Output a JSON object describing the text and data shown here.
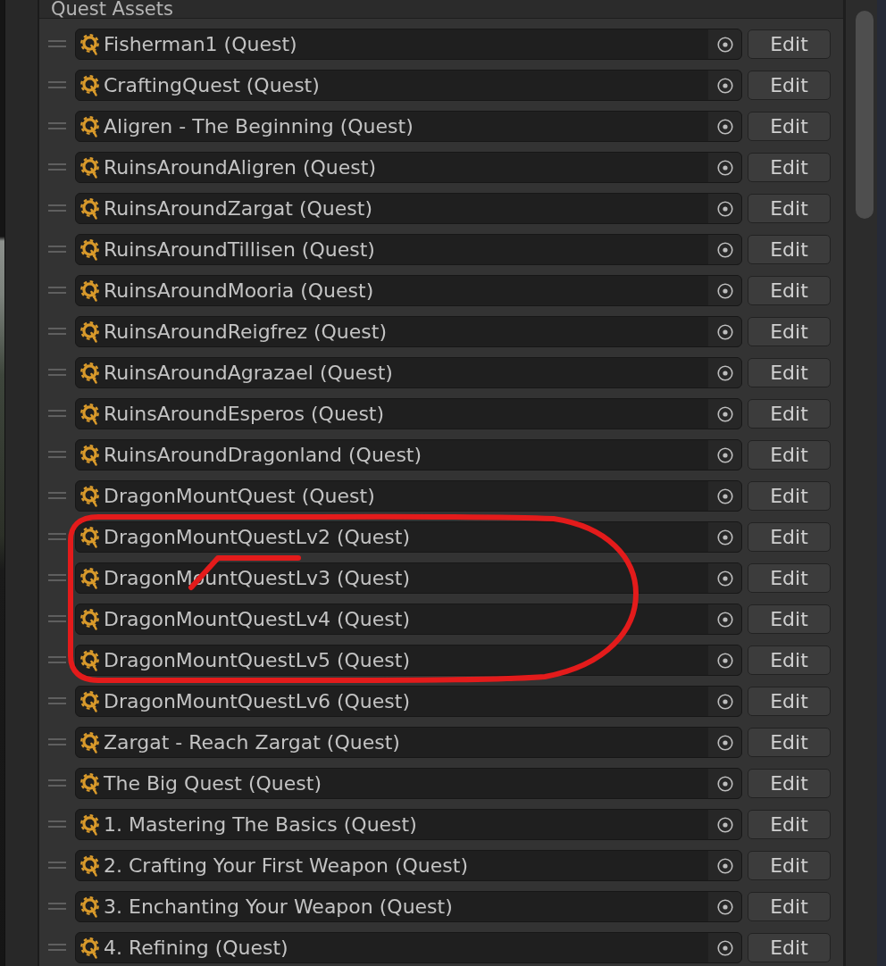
{
  "panel": {
    "title": "Quest Assets"
  },
  "quests": [
    {
      "name": "Fisherman1 (Quest)",
      "button": "Edit"
    },
    {
      "name": "CraftingQuest (Quest)",
      "button": "Edit"
    },
    {
      "name": "Aligren - The Beginning (Quest)",
      "button": "Edit"
    },
    {
      "name": "RuinsAroundAligren (Quest)",
      "button": "Edit"
    },
    {
      "name": "RuinsAroundZargat (Quest)",
      "button": "Edit"
    },
    {
      "name": "RuinsAroundTillisen (Quest)",
      "button": "Edit"
    },
    {
      "name": "RuinsAroundMooria (Quest)",
      "button": "Edit"
    },
    {
      "name": "RuinsAroundReigfrez (Quest)",
      "button": "Edit"
    },
    {
      "name": "RuinsAroundAgrazael (Quest)",
      "button": "Edit"
    },
    {
      "name": "RuinsAroundEsperos (Quest)",
      "button": "Edit"
    },
    {
      "name": "RuinsAroundDragonland (Quest)",
      "button": "Edit"
    },
    {
      "name": "DragonMountQuest (Quest)",
      "button": "Edit"
    },
    {
      "name": "DragonMountQuestLv2 (Quest)",
      "button": "Edit"
    },
    {
      "name": "DragonMountQuestLv3 (Quest)",
      "button": "Edit"
    },
    {
      "name": "DragonMountQuestLv4 (Quest)",
      "button": "Edit"
    },
    {
      "name": "DragonMountQuestLv5 (Quest)",
      "button": "Edit"
    },
    {
      "name": "DragonMountQuestLv6 (Quest)",
      "button": "Edit"
    },
    {
      "name": "Zargat - Reach Zargat (Quest)",
      "button": "Edit"
    },
    {
      "name": "The Big Quest (Quest)",
      "button": "Edit"
    },
    {
      "name": "1. Mastering The Basics (Quest)",
      "button": "Edit"
    },
    {
      "name": "2. Crafting Your First Weapon (Quest)",
      "button": "Edit"
    },
    {
      "name": "3. Enchanting Your Weapon (Quest)",
      "button": "Edit"
    },
    {
      "name": "4. Refining (Quest)",
      "button": "Edit"
    }
  ]
}
